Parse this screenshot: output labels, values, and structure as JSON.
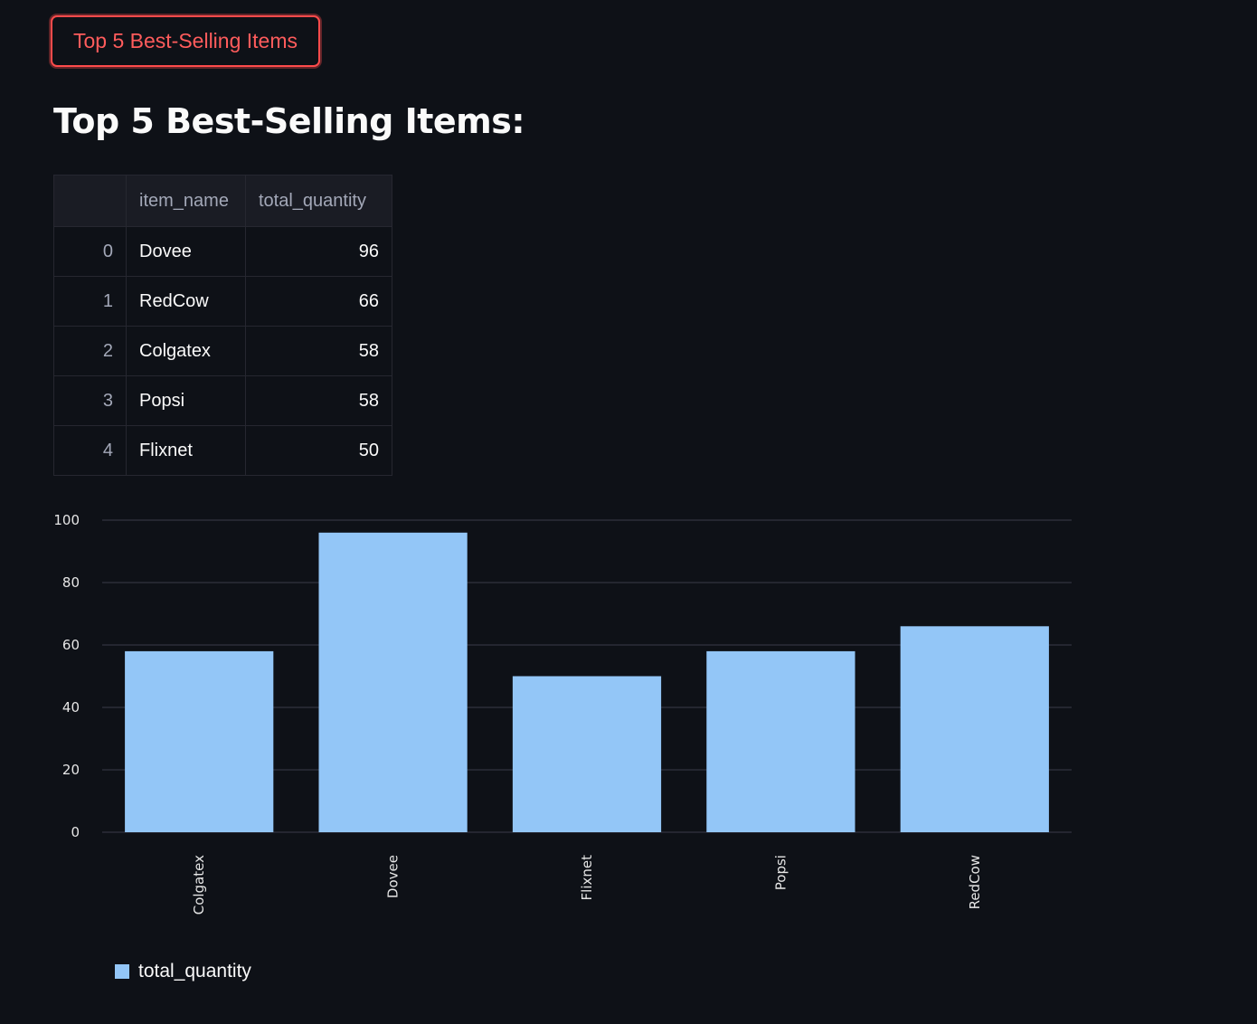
{
  "button": {
    "label": "Top 5 Best-Selling Items"
  },
  "heading": "Top 5 Best-Selling Items:",
  "table": {
    "columns": [
      "",
      "item_name",
      "total_quantity"
    ],
    "rows": [
      {
        "index": "0",
        "item_name": "Dovee",
        "total_quantity": "96"
      },
      {
        "index": "1",
        "item_name": "RedCow",
        "total_quantity": "66"
      },
      {
        "index": "2",
        "item_name": "Colgatex",
        "total_quantity": "58"
      },
      {
        "index": "3",
        "item_name": "Popsi",
        "total_quantity": "58"
      },
      {
        "index": "4",
        "item_name": "Flixnet",
        "total_quantity": "50"
      }
    ]
  },
  "chart_data": {
    "type": "bar",
    "categories": [
      "Colgatex",
      "Dovee",
      "Flixnet",
      "Popsi",
      "RedCow"
    ],
    "series": [
      {
        "name": "total_quantity",
        "values": [
          58,
          96,
          50,
          58,
          66
        ]
      }
    ],
    "yticks": [
      0,
      20,
      40,
      60,
      80,
      100
    ],
    "ylim": [
      0,
      100
    ],
    "grid": true,
    "legend": "bottom-left",
    "bar_color": "#93c6f7"
  },
  "colors": {
    "background": "#0e1117",
    "accent": "#ff4b4b",
    "bar": "#93c6f7",
    "grid": "#31333f"
  }
}
